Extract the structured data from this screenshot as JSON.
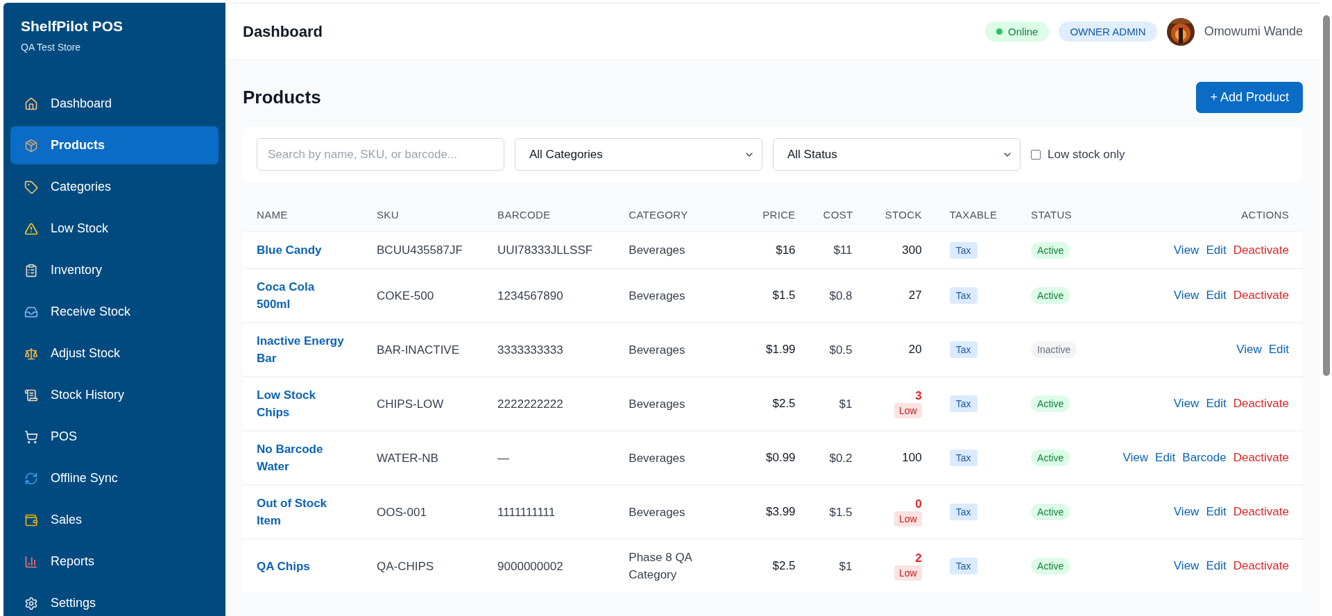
{
  "sidebar": {
    "brand": "ShelfPilot POS",
    "store": "QA Test Store",
    "items": [
      {
        "label": "Dashboard",
        "selected": false
      },
      {
        "label": "Products",
        "selected": true
      },
      {
        "label": "Categories",
        "selected": false
      },
      {
        "label": "Low Stock",
        "selected": false
      },
      {
        "label": "Inventory",
        "selected": false
      },
      {
        "label": "Receive Stock",
        "selected": false
      },
      {
        "label": "Adjust Stock",
        "selected": false
      },
      {
        "label": "Stock History",
        "selected": false
      },
      {
        "label": "POS",
        "selected": false
      },
      {
        "label": "Offline Sync",
        "selected": false
      },
      {
        "label": "Sales",
        "selected": false
      },
      {
        "label": "Reports",
        "selected": false
      },
      {
        "label": "Settings",
        "selected": false
      }
    ]
  },
  "header": {
    "title": "Dashboard",
    "status": {
      "label": "Online",
      "color": "#22c55e"
    },
    "role": "OWNER ADMIN",
    "user": "Omowumi Wande"
  },
  "page": {
    "title": "Products",
    "add_button": "+ Add Product"
  },
  "filters": {
    "search": {
      "placeholder": "Search by name, SKU, or barcode..."
    },
    "category": "All Categories",
    "status": "All Status",
    "low_stock_only": {
      "label": "Low stock only",
      "checked": false
    }
  },
  "table": {
    "columns": [
      "NAME",
      "SKU",
      "BARCODE",
      "CATEGORY",
      "PRICE",
      "COST",
      "STOCK",
      "TAXABLE",
      "STATUS",
      "ACTIONS"
    ],
    "rows": [
      {
        "name": "Blue Candy",
        "sku": "BCUU435587JF",
        "barcode": "UUI78333JLLSSF",
        "category": "Beverages",
        "price": "$16",
        "cost": "$11",
        "stock": "300",
        "low": false,
        "taxable": "Tax",
        "status": "Active",
        "active": true,
        "actions": [
          {
            "label": "View",
            "kind": "link"
          },
          {
            "label": "Edit",
            "kind": "link"
          },
          {
            "label": "Deactivate",
            "kind": "danger"
          }
        ]
      },
      {
        "name": "Coca Cola 500ml",
        "sku": "COKE-500",
        "barcode": "1234567890",
        "category": "Beverages",
        "price": "$1.5",
        "cost": "$0.8",
        "stock": "27",
        "low": false,
        "taxable": "Tax",
        "status": "Active",
        "active": true,
        "actions": [
          {
            "label": "View",
            "kind": "link"
          },
          {
            "label": "Edit",
            "kind": "link"
          },
          {
            "label": "Deactivate",
            "kind": "danger"
          }
        ]
      },
      {
        "name": "Inactive Energy Bar",
        "sku": "BAR-INACTIVE",
        "barcode": "3333333333",
        "category": "Beverages",
        "price": "$1.99",
        "cost": "$0.5",
        "stock": "20",
        "low": false,
        "taxable": "Tax",
        "status": "Inactive",
        "active": false,
        "actions": [
          {
            "label": "View",
            "kind": "link"
          },
          {
            "label": "Edit",
            "kind": "link"
          }
        ]
      },
      {
        "name": "Low Stock Chips",
        "sku": "CHIPS-LOW",
        "barcode": "2222222222",
        "category": "Beverages",
        "price": "$2.5",
        "cost": "$1",
        "stock": "3",
        "low": true,
        "low_label": "Low",
        "taxable": "Tax",
        "status": "Active",
        "active": true,
        "actions": [
          {
            "label": "View",
            "kind": "link"
          },
          {
            "label": "Edit",
            "kind": "link"
          },
          {
            "label": "Deactivate",
            "kind": "danger"
          }
        ]
      },
      {
        "name": "No Barcode Water",
        "sku": "WATER-NB",
        "barcode": "—",
        "category": "Beverages",
        "price": "$0.99",
        "cost": "$0.2",
        "stock": "100",
        "low": false,
        "taxable": "Tax",
        "status": "Active",
        "active": true,
        "actions": [
          {
            "label": "View",
            "kind": "link"
          },
          {
            "label": "Edit",
            "kind": "link"
          },
          {
            "label": "Barcode",
            "kind": "link"
          },
          {
            "label": "Deactivate",
            "kind": "danger"
          }
        ]
      },
      {
        "name": "Out of Stock Item",
        "sku": "OOS-001",
        "barcode": "1111111111",
        "category": "Beverages",
        "price": "$3.99",
        "cost": "$1.5",
        "stock": "0",
        "low": true,
        "low_label": "Low",
        "taxable": "Tax",
        "status": "Active",
        "active": true,
        "actions": [
          {
            "label": "View",
            "kind": "link"
          },
          {
            "label": "Edit",
            "kind": "link"
          },
          {
            "label": "Deactivate",
            "kind": "danger"
          }
        ]
      },
      {
        "name": "QA Chips",
        "sku": "QA-CHIPS",
        "barcode": "9000000002",
        "category": "Phase 8 QA Category",
        "price": "$2.5",
        "cost": "$1",
        "stock": "2",
        "low": true,
        "low_label": "Low",
        "taxable": "Tax",
        "status": "Active",
        "active": true,
        "actions": [
          {
            "label": "View",
            "kind": "link"
          },
          {
            "label": "Edit",
            "kind": "link"
          },
          {
            "label": "Deactivate",
            "kind": "danger"
          }
        ]
      }
    ]
  }
}
